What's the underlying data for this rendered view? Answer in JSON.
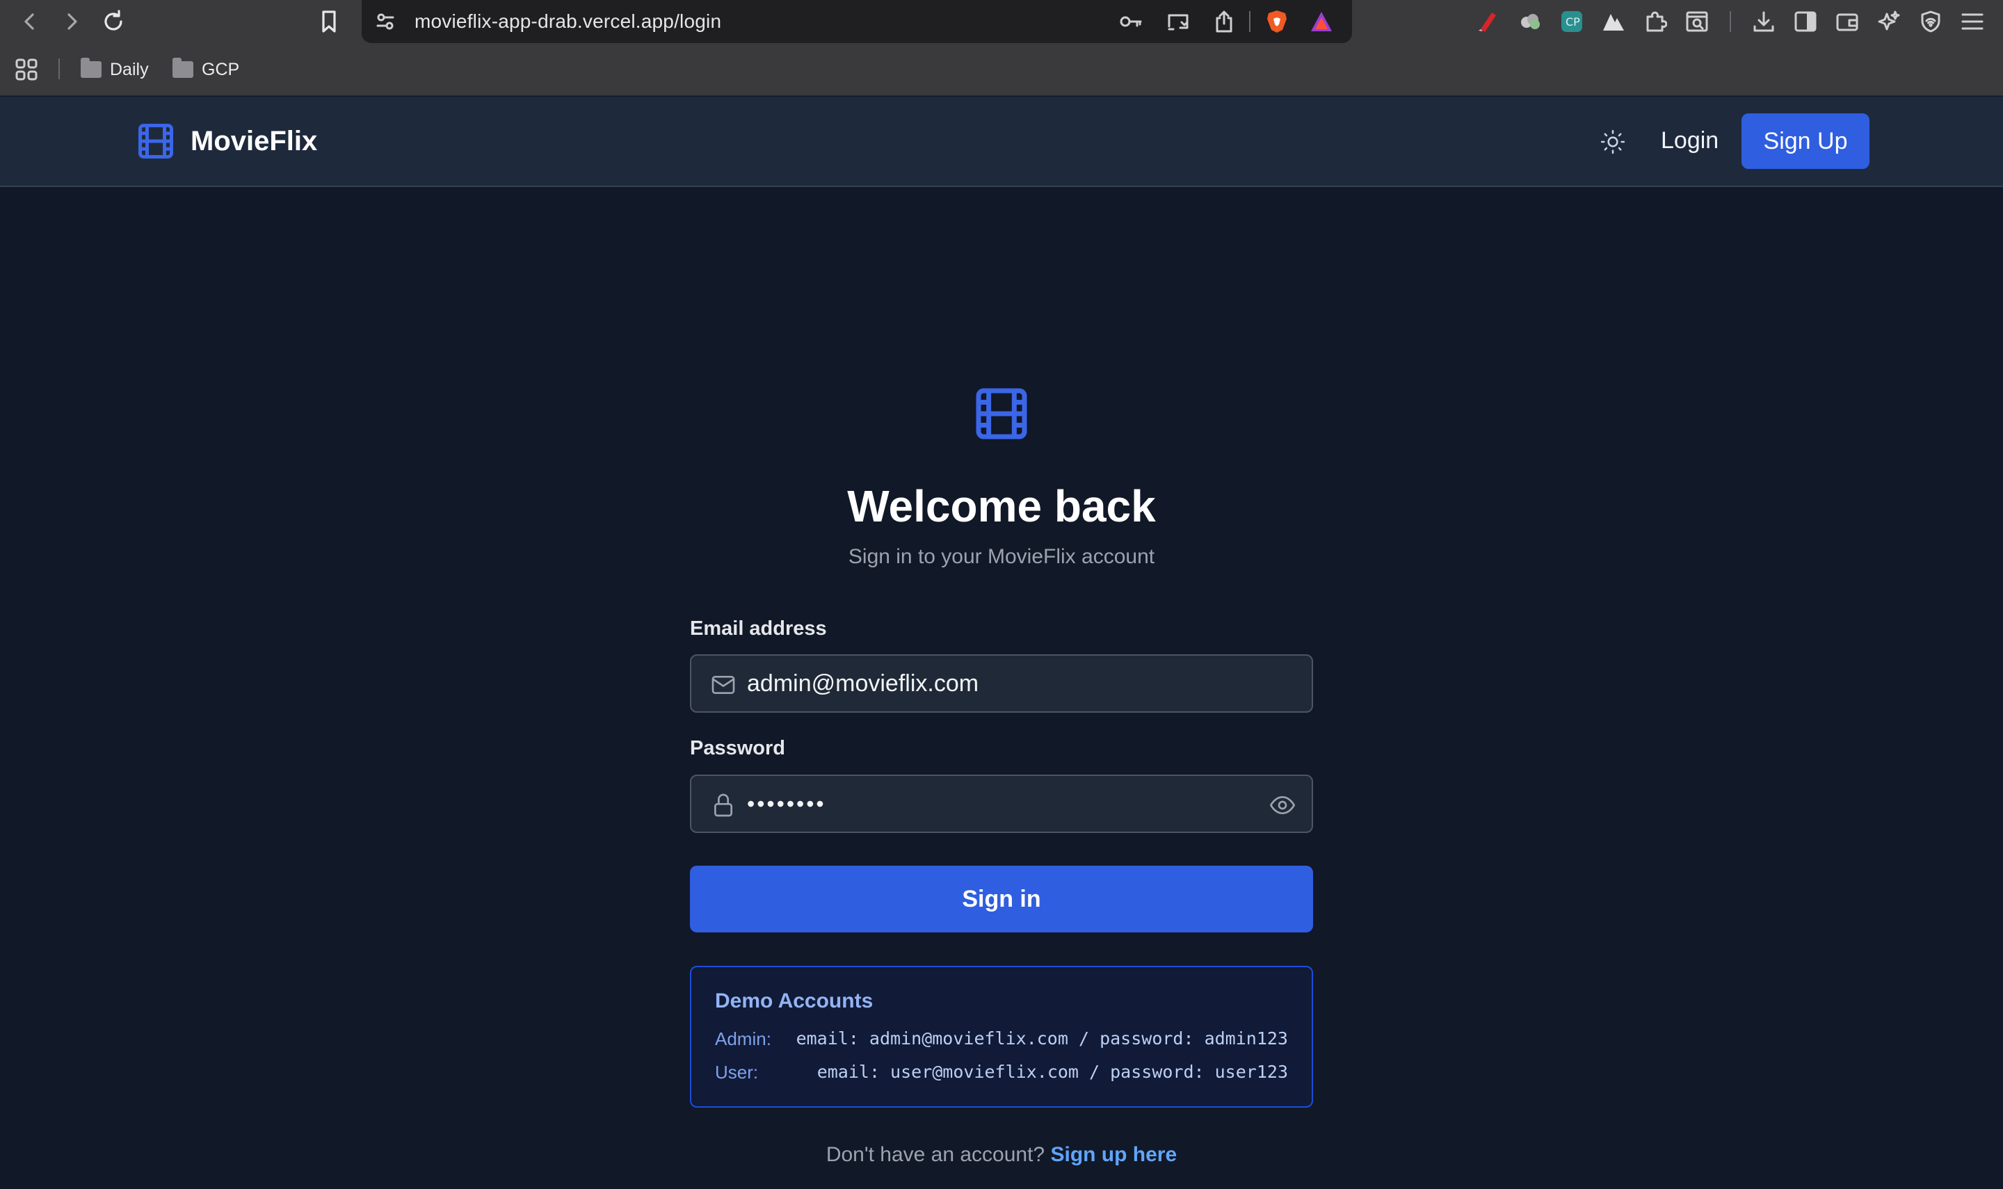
{
  "browser": {
    "url": "movieflix-app-drab.vercel.app/login",
    "bookmarks": [
      {
        "label": "Daily"
      },
      {
        "label": "GCP"
      }
    ]
  },
  "nav": {
    "brand": "MovieFlix",
    "login_label": "Login",
    "signup_label": "Sign Up"
  },
  "login": {
    "title": "Welcome back",
    "subtitle": "Sign in to your MovieFlix account",
    "email_label": "Email address",
    "email_value": "admin@movieflix.com",
    "password_label": "Password",
    "password_mask": "••••••••",
    "submit_label": "Sign in"
  },
  "demo": {
    "title": "Demo Accounts",
    "accounts": [
      {
        "role": "Admin:",
        "credentials": "email: admin@movieflix.com / password: admin123"
      },
      {
        "role": "User:",
        "credentials": "email: user@movieflix.com / password: user123"
      }
    ]
  },
  "footer": {
    "prompt": "Don't have an account?",
    "link": "Sign up here"
  },
  "colors": {
    "accent": "#2f5ee0",
    "background": "#111827",
    "navbar": "#1e293b",
    "link": "#60a5fa"
  },
  "icons": {
    "brand": "film-icon",
    "theme": "sun-icon",
    "email": "mail-icon",
    "password": "lock-icon",
    "reveal": "eye-icon"
  }
}
